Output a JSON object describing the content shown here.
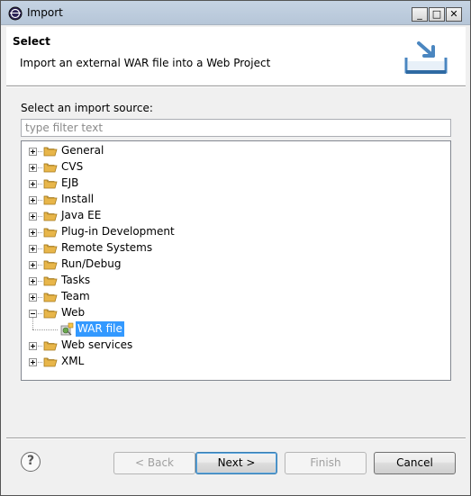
{
  "window": {
    "title": "Import",
    "minimize_glyph": "_",
    "maximize_glyph": "□",
    "close_glyph": "✕"
  },
  "header": {
    "title": "Select",
    "description": "Import an external WAR file into a Web Project"
  },
  "source": {
    "label": "Select an import source:",
    "filter_placeholder": "type filter text",
    "filter_value": ""
  },
  "tree": {
    "items": [
      {
        "label": "General",
        "expanded": false
      },
      {
        "label": "CVS",
        "expanded": false
      },
      {
        "label": "EJB",
        "expanded": false
      },
      {
        "label": "Install",
        "expanded": false
      },
      {
        "label": "Java EE",
        "expanded": false
      },
      {
        "label": "Plug-in Development",
        "expanded": false
      },
      {
        "label": "Remote Systems",
        "expanded": false
      },
      {
        "label": "Run/Debug",
        "expanded": false
      },
      {
        "label": "Tasks",
        "expanded": false
      },
      {
        "label": "Team",
        "expanded": false
      },
      {
        "label": "Web",
        "expanded": true
      },
      {
        "label": "Web services",
        "expanded": false
      },
      {
        "label": "XML",
        "expanded": false
      }
    ],
    "web_child": {
      "label": "WAR file",
      "selected": true
    }
  },
  "buttons": {
    "help": "?",
    "back": "< Back",
    "next": "Next >",
    "finish": "Finish",
    "cancel": "Cancel"
  },
  "colors": {
    "selection": "#3399ff",
    "folder": "#e8b64a"
  },
  "icons": {
    "app": "eclipse-icon",
    "wizard": "import-tray-icon",
    "folder": "folder-icon",
    "war": "war-file-icon",
    "help": "help-icon"
  }
}
